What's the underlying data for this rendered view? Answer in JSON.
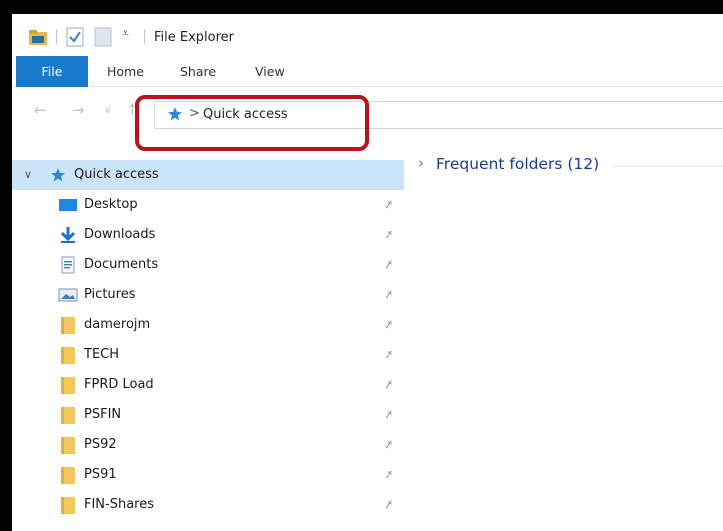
{
  "window": {
    "title": "File Explorer"
  },
  "ribbon": {
    "file_label": "File",
    "tabs": [
      {
        "label": "Home"
      },
      {
        "label": "Share"
      },
      {
        "label": "View"
      }
    ]
  },
  "address": {
    "path_label": "Quick access",
    "separator": ">"
  },
  "navpane": {
    "quick_access_label": "Quick access",
    "items": [
      {
        "label": "Desktop",
        "icon": "desktop-icon"
      },
      {
        "label": "Downloads",
        "icon": "downloads-icon"
      },
      {
        "label": "Documents",
        "icon": "documents-icon"
      },
      {
        "label": "Pictures",
        "icon": "pictures-icon"
      },
      {
        "label": "damerojm",
        "icon": "folder-icon"
      },
      {
        "label": "TECH",
        "icon": "folder-icon"
      },
      {
        "label": "FPRD Load",
        "icon": "folder-icon"
      },
      {
        "label": "PSFIN",
        "icon": "folder-icon"
      },
      {
        "label": "PS92",
        "icon": "folder-icon"
      },
      {
        "label": "PS91",
        "icon": "folder-icon"
      },
      {
        "label": "FIN-Shares",
        "icon": "folder-icon"
      }
    ]
  },
  "content": {
    "group_title": "Frequent folders (12)"
  },
  "colors": {
    "accent": "#1979ca",
    "selection": "#cce4f7",
    "highlight": "#b4141e",
    "group_title": "#1e3a8a"
  }
}
